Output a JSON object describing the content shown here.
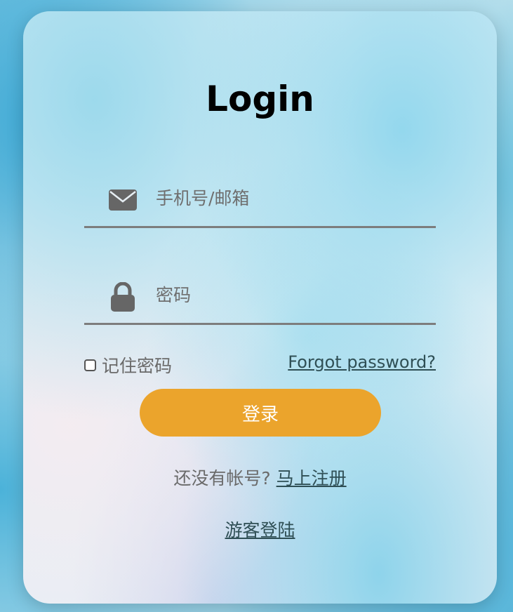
{
  "login_form": {
    "title": "Login",
    "email_field": {
      "icon": "envelope-icon",
      "placeholder": "手机号/邮箱",
      "value": ""
    },
    "password_field": {
      "icon": "lock-icon",
      "placeholder": "密码",
      "value": ""
    },
    "remember_label": "记住密码",
    "remember_checked": false,
    "forgot_label": "Forgot password?",
    "submit_label": "登录",
    "signup_prompt": "还没有帐号?",
    "signup_link": "马上注册",
    "guest_link": "游客登陆"
  },
  "colors": {
    "accent": "#eba42c",
    "link": "#2f4f55",
    "underline": "#7d7d7d"
  }
}
